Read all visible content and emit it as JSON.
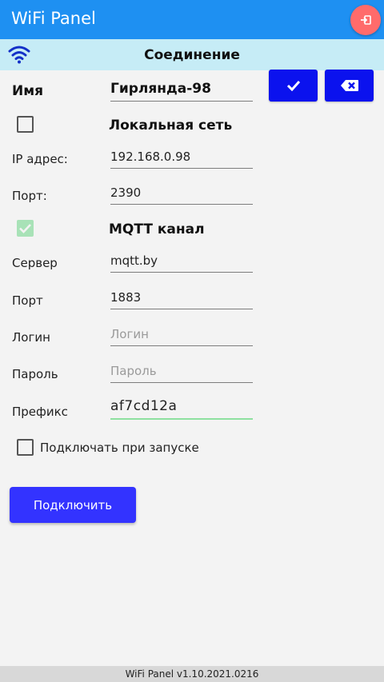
{
  "app": {
    "title": "WiFi Panel",
    "exit_icon": "exit-icon"
  },
  "section": {
    "title": "Соединение",
    "icon": "wifi-icon"
  },
  "actions": {
    "confirm_icon": "check-icon",
    "clear_icon": "backspace-x-icon"
  },
  "form": {
    "name_label": "Имя",
    "name_value": "Гирлянда-98",
    "local_label": "Локальная сеть",
    "local_checked": false,
    "ip_label": "IP адрес:",
    "ip_value": "192.168.0.98",
    "port_label": "Порт:",
    "port_value": "2390",
    "mqtt_label": "MQTT канал",
    "mqtt_checked": true,
    "server_label": "Сервер",
    "server_value": "mqtt.by",
    "mqtt_port_label": "Порт",
    "mqtt_port_value": "1883",
    "login_label": "Логин",
    "login_placeholder": "Логин",
    "password_label": "Пароль",
    "password_placeholder": "Пароль",
    "prefix_label": "Префикс",
    "prefix_value": "af7cd12a",
    "autoconnect_label": "Подключать при запуске",
    "autoconnect_checked": false
  },
  "connect_button": "Подключить",
  "footer": "WiFi Panel v1.10.2021.0216",
  "colors": {
    "appbar": "#1e90f2",
    "section_bar": "#c6ecf6",
    "action_button": "#0b12ee",
    "connect_button": "#3333ff",
    "exit_button": "#ff6b6b",
    "checked": "#a8e2b7"
  }
}
